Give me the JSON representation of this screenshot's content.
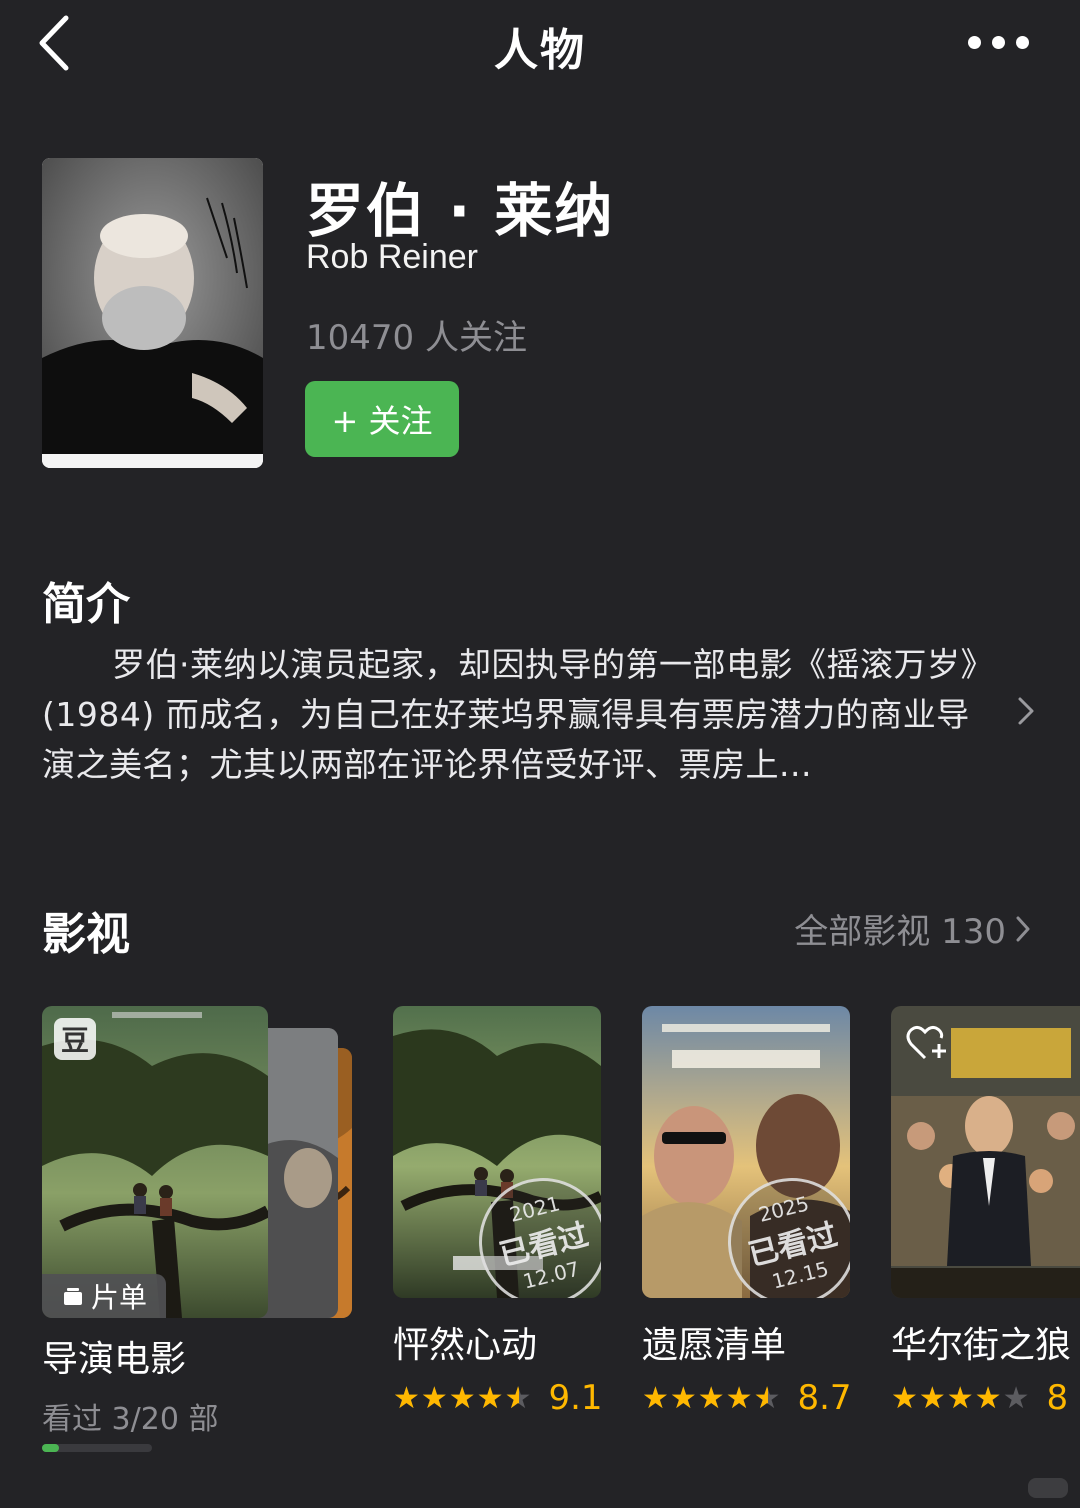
{
  "nav": {
    "title": "人物",
    "back_icon": "chevron-left-icon",
    "more_icon": "ellipsis-icon"
  },
  "person": {
    "name_cn": "罗伯 · 莱纳",
    "name_en": "Rob Reiner",
    "followers": "10470 人关注",
    "follow_label": "+ 关注"
  },
  "intro": {
    "title": "简介",
    "text": "罗伯·莱纳以演员起家，却因执导的第一部电影《摇滚万岁》(1984) 而成名，为自己在好莱坞界赢得具有票房潜力的商业导演之美名；尤其以两部在评论界倍受好评、票房上..."
  },
  "works": {
    "title": "影视",
    "all_label": "全部影视 130",
    "list": {
      "badge": "豆",
      "tag_label": "片单",
      "title": "导演电影",
      "progress_text": "看过 3/20 部",
      "progress": 0.15
    },
    "movies": [
      {
        "title": "怦然心动",
        "score": "9.1",
        "stars": 4.5,
        "seen": {
          "year": "2021",
          "label": "已看过",
          "date": "12.07"
        }
      },
      {
        "title": "遗愿清单",
        "score": "8.7",
        "stars": 4.5,
        "seen": {
          "year": "2025",
          "label": "已看过",
          "date": "12.15"
        }
      },
      {
        "title": "华尔街之狼",
        "score": "8",
        "stars": 4,
        "seen": null
      }
    ]
  },
  "colors": {
    "background": "#232326",
    "accent_green": "#4bb553",
    "star": "#ffb800",
    "muted": "#8e8e93"
  }
}
